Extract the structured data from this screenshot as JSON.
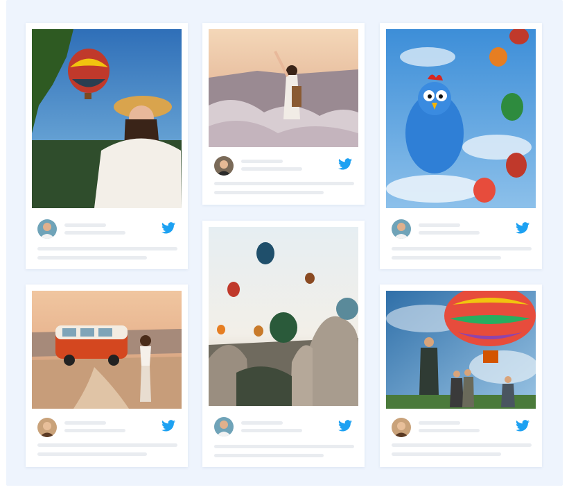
{
  "board": {
    "background": "#eef4fd"
  },
  "cards": [
    {
      "id": "card-1",
      "photo": "woman-straw-hat-balloons",
      "network_icon": "twitter-bird-icon"
    },
    {
      "id": "card-2",
      "photo": "woman-raised-arm-valley",
      "network_icon": "twitter-bird-icon"
    },
    {
      "id": "card-3",
      "photo": "blue-rooster-balloon-sky",
      "network_icon": "twitter-bird-icon"
    },
    {
      "id": "card-4",
      "photo": "orange-van-woman-road",
      "network_icon": "twitter-bird-icon"
    },
    {
      "id": "card-5",
      "photo": "balloons-over-rock-formations",
      "network_icon": "twitter-bird-icon"
    },
    {
      "id": "card-6",
      "photo": "people-under-rainbow-balloon",
      "network_icon": "twitter-bird-icon"
    }
  ],
  "colors": {
    "twitter": "#1da1f2",
    "placeholder_line": "#e9ecf0"
  }
}
